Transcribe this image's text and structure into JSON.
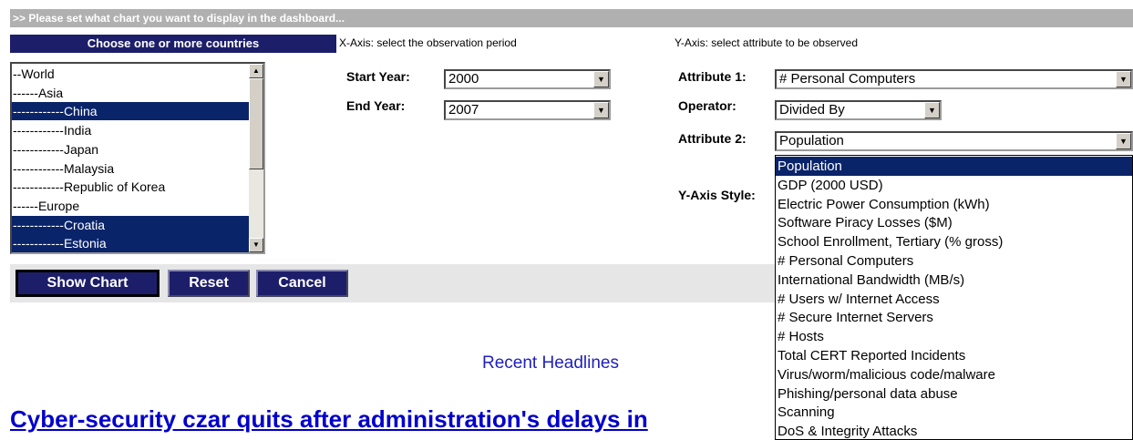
{
  "banner": ">> Please set what chart you want to display in the dashboard...",
  "countries": {
    "header": "Choose one or more countries",
    "items": [
      {
        "label": "--World",
        "selected": false
      },
      {
        "label": "------Asia",
        "selected": false
      },
      {
        "label": "------------China",
        "selected": true
      },
      {
        "label": "------------India",
        "selected": false
      },
      {
        "label": "------------Japan",
        "selected": false
      },
      {
        "label": "------------Malaysia",
        "selected": false
      },
      {
        "label": "------------Republic of Korea",
        "selected": false
      },
      {
        "label": "------Europe",
        "selected": false
      },
      {
        "label": "------------Croatia",
        "selected": true
      },
      {
        "label": "------------Estonia",
        "selected": true
      }
    ]
  },
  "xaxis": {
    "header": "X-Axis: select the observation period",
    "start_label": "Start Year:",
    "start_value": "2000",
    "end_label": "End Year:",
    "end_value": "2007"
  },
  "yaxis": {
    "header": "Y-Axis: select attribute to be observed",
    "attr1_label": "Attribute 1:",
    "attr1_value": "# Personal Computers",
    "operator_label": "Operator:",
    "operator_value": "Divided By",
    "attr2_label": "Attribute 2:",
    "attr2_value": "Population",
    "style_label": "Y-Axis Style:",
    "attr2_options": [
      "Population",
      "GDP (2000 USD)",
      "Electric Power Consumption (kWh)",
      "Software Piracy Losses ($M)",
      "School Enrollment, Tertiary (% gross)",
      "# Personal Computers",
      "International Bandwidth (MB/s)",
      "# Users w/ Internet Access",
      "# Secure Internet Servers",
      "# Hosts",
      "Total CERT Reported Incidents",
      "Virus/worm/malicious code/malware",
      "Phishing/personal data abuse",
      "Scanning",
      "DoS & Integrity Attacks"
    ],
    "highlighted_option": "Population"
  },
  "buttons": {
    "show_chart": "Show Chart",
    "reset": "Reset",
    "cancel": "Cancel"
  },
  "recent_headlines_label": "Recent Headlines",
  "headline": "Cyber-security czar quits after administration's delays in",
  "colors": {
    "navy": "#1d1e6a",
    "selection": "#0a246a",
    "banner_gray": "#b0b0b0",
    "link_blue": "#0000cc"
  }
}
